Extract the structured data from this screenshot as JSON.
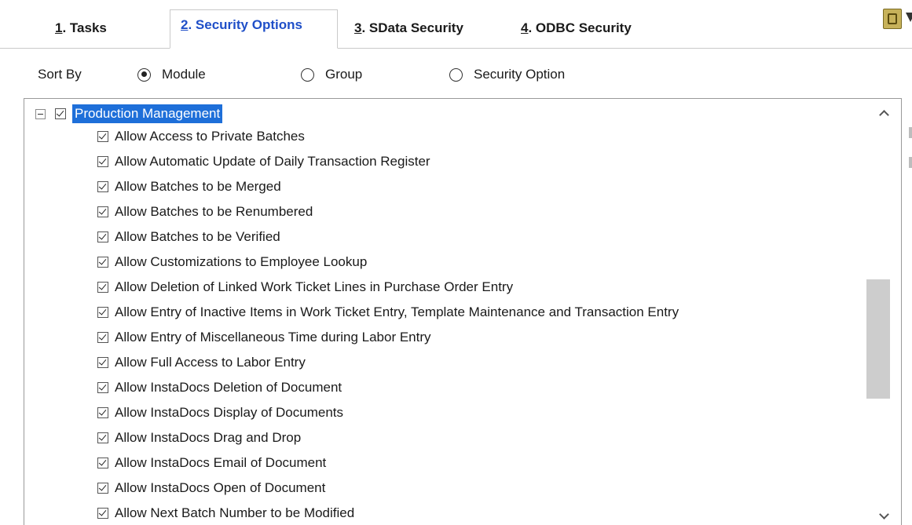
{
  "tabs": [
    {
      "mnemonic": "1",
      "label": ". Tasks",
      "active": false
    },
    {
      "mnemonic": "2",
      "label": ". Security Options",
      "active": true
    },
    {
      "mnemonic": "3",
      "label": ". SData Security",
      "active": false
    },
    {
      "mnemonic": "4",
      "label": ". ODBC Security",
      "active": false
    }
  ],
  "toolbar": {
    "icon": "binoculars-icon",
    "more_icon": "dropdown-arrow-icon"
  },
  "sort": {
    "label": "Sort By",
    "options": [
      {
        "label": "Module",
        "selected": true
      },
      {
        "label": "Group",
        "selected": false
      },
      {
        "label": "Security Option",
        "selected": false
      }
    ]
  },
  "tree": {
    "root": {
      "label": "Production Management",
      "checked": true,
      "expanded": true,
      "selected": true
    },
    "children": [
      {
        "label": "Allow Access to Private Batches",
        "checked": true
      },
      {
        "label": "Allow Automatic Update of Daily Transaction Register",
        "checked": true
      },
      {
        "label": "Allow Batches to be Merged",
        "checked": true
      },
      {
        "label": "Allow Batches to be Renumbered",
        "checked": true
      },
      {
        "label": "Allow Batches to be Verified",
        "checked": true
      },
      {
        "label": "Allow Customizations to Employee Lookup",
        "checked": true
      },
      {
        "label": "Allow Deletion of Linked Work Ticket Lines in Purchase Order Entry",
        "checked": true
      },
      {
        "label": "Allow Entry of Inactive Items in Work Ticket Entry, Template Maintenance and Transaction Entry",
        "checked": true
      },
      {
        "label": "Allow Entry of Miscellaneous Time during Labor Entry",
        "checked": true
      },
      {
        "label": "Allow Full Access to Labor Entry",
        "checked": true
      },
      {
        "label": "Allow InstaDocs Deletion of Document",
        "checked": true
      },
      {
        "label": "Allow InstaDocs Display of Documents",
        "checked": true
      },
      {
        "label": "Allow InstaDocs Drag and Drop",
        "checked": true
      },
      {
        "label": "Allow InstaDocs Email of Document",
        "checked": true
      },
      {
        "label": "Allow InstaDocs Open of Document",
        "checked": true
      },
      {
        "label": "Allow Next Batch Number to be Modified",
        "checked": true
      }
    ]
  },
  "colors": {
    "accent": "#1f4fc8",
    "selection": "#1e6fd9",
    "border": "#9a9a9a",
    "scroll_thumb": "#cdcdcd"
  }
}
